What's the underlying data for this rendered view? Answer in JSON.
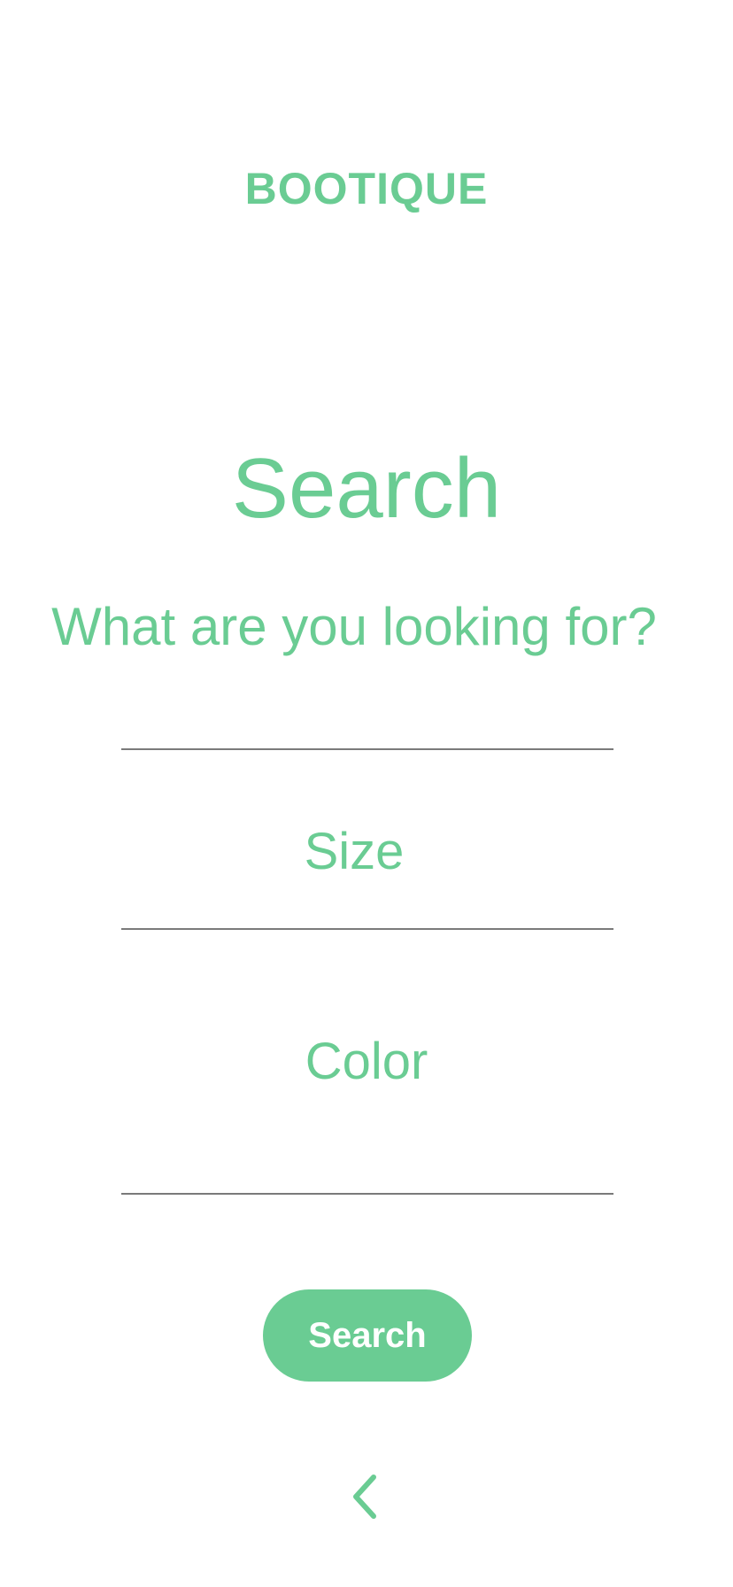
{
  "header": {
    "logo_text": "BOOTIQUE"
  },
  "main": {
    "title": "Search",
    "question": "What are you looking for?",
    "fields": {
      "size_label": "Size",
      "color_label": "Color"
    },
    "search_button_label": "Search"
  },
  "navigation": {
    "back_icon": "chevron-left-icon"
  },
  "colors": {
    "accent": "#6acc93",
    "divider": "#7a7a7a",
    "background": "#ffffff"
  }
}
